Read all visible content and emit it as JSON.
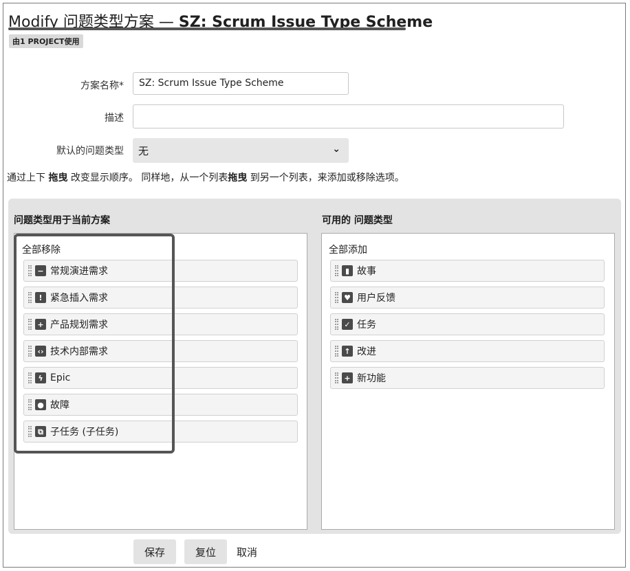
{
  "header": {
    "title_prefix": "Modify 问题类型方案 — ",
    "title_scheme": "SZ: Scrum Issue Type Scheme",
    "badge": "由1 PROJECT使用"
  },
  "form": {
    "name_label": "方案名称*",
    "name_value": "SZ: Scrum Issue Type Scheme",
    "desc_label": "描述",
    "desc_value": "",
    "default_label": "默认的问题类型",
    "default_value": "无"
  },
  "hint": {
    "part1": "通过上下 ",
    "drag1": "拖曳",
    "part2": " 改变显示顺序。 同样地，从一个列表",
    "drag2": "拖曳",
    "part3": " 到另一个列表，来添加或移除选项。"
  },
  "current": {
    "title": "问题类型用于当前方案",
    "action": "全部移除",
    "items": [
      {
        "label": "常规演进需求",
        "icon": "minus-icon",
        "glyph": "−"
      },
      {
        "label": "紧急插入需求",
        "icon": "exclamation-icon",
        "glyph": "!"
      },
      {
        "label": "产品规划需求",
        "icon": "plus-icon",
        "glyph": "+"
      },
      {
        "label": "技术内部需求",
        "icon": "code-icon",
        "glyph": "‹›"
      },
      {
        "label": "Epic",
        "icon": "lightning-icon",
        "glyph": "ϟ"
      },
      {
        "label": "故障",
        "icon": "bug-icon",
        "glyph": "●"
      },
      {
        "label": "子任务 (子任务)",
        "icon": "subtask-icon",
        "glyph": "⧉"
      }
    ]
  },
  "available": {
    "title": "可用的 问题类型",
    "action": "全部添加",
    "items": [
      {
        "label": "故事",
        "icon": "bookmark-icon",
        "glyph": "▮"
      },
      {
        "label": "用户反馈",
        "icon": "heart-icon",
        "glyph": "♥"
      },
      {
        "label": "任务",
        "icon": "check-icon",
        "glyph": "✓"
      },
      {
        "label": "改进",
        "icon": "arrow-up-icon",
        "glyph": "↑"
      },
      {
        "label": "新功能",
        "icon": "plus-icon",
        "glyph": "+"
      }
    ]
  },
  "buttons": {
    "save": "保存",
    "reset": "复位",
    "cancel": "取消"
  }
}
